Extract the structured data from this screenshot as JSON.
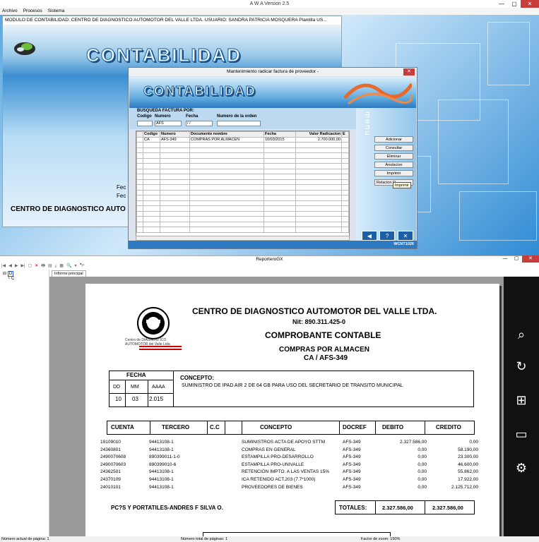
{
  "app": {
    "title": "A W A Version 2.5",
    "menu": [
      "Archivo",
      "Procesos",
      "Sistema"
    ],
    "minimize": "—",
    "maximize": "▢",
    "close": "✕"
  },
  "module": {
    "title": "MODULO DE CONTABILIDAD: CENTRO DE DIAGNOSTICO AUTOMOTOR DEL VALLE LTDA.    USUARIO:  SANDRA PATRICIA MOSQUERA  Plantilla US...",
    "banner": "CONTABILIDAD",
    "fec1": "Fec",
    "fec2": "Fec",
    "company": "CENTRO DE DIAGNOSTICO AUTO"
  },
  "dialog": {
    "title": "Mantenimiento radicar factura de proveedor -",
    "close": "✕",
    "banner": "CONTABILIDAD",
    "search_title": "BUSQUEDA FACTURA POR:",
    "search_labels": {
      "codigo": "Codigo",
      "numero": "Numero",
      "fecha": "Fecha",
      "orden": "Numero de la orden"
    },
    "search_values": {
      "codigo": "",
      "numero": "AFS",
      "fecha": "  /  /",
      "orden": ""
    },
    "grid_headers": [
      "Codigo",
      "Numero",
      "Documento nombre",
      "Fecha",
      "Valor Radicacion",
      "E"
    ],
    "grid_rows": [
      [
        "CA",
        "AFS-349",
        "COMPRAS POR ALMACEN",
        "10/03/2015",
        "2.700.000,00",
        ""
      ]
    ],
    "menu_word": "menu",
    "buttons": [
      "Adicionar",
      "Consultar",
      "Eliminar",
      "Anulacion",
      "Imprimir",
      "Relacion O"
    ],
    "tooltip": "Imprimir",
    "nav": [
      "◀",
      "?",
      "✕"
    ],
    "status_id": "WCNT1026"
  },
  "report": {
    "title": "ReporteroGX",
    "close": "✕",
    "toolbar": [
      "|◀",
      "◀",
      "▶",
      "▶|",
      "▢",
      "✕",
      "🖶",
      "▤",
      "⤓",
      "▦",
      "🔍",
      "▾",
      "🔭"
    ],
    "tree": [
      "D",
      "C"
    ],
    "tab": "Informe principal",
    "company": "CENTRO DE DIAGNOSTICO AUTOMOTOR DEL VALLE LTDA.",
    "nit": "Nit: 890.311.425-0",
    "doc_title": "COMPROBANTE CONTABLE",
    "doc_type": "COMPRAS POR ALMACEN",
    "doc_number": "CA /  AFS-349",
    "logo_text1": "Centro de DIAGNOSTICO",
    "logo_text2": "AUTOMOTOR del Valle Ltda",
    "fecha_label": "FECHA",
    "fecha_heads": [
      "DD",
      "MM",
      "AAAA"
    ],
    "fecha_vals": [
      "10",
      "03",
      "2.015"
    ],
    "concepto_label": "CONCEPTO:",
    "concepto": "SUMINISTRO DE IPAD AIR 2 DE 64 GB PARA USO DEL SECRETARIO DE TRANSITO MUNICIPAL",
    "col_heads": [
      "CUENTA",
      "TERCERO",
      "C.C",
      "CONCEPTO",
      "DOCREF",
      "DEBITO",
      "CREDITO"
    ],
    "rows": [
      [
        "19109010",
        "94413108-1",
        "SUMINISTROS ACTA DE APOYO STTM",
        "AFS-349",
        "2.327.586,00",
        "0,00"
      ],
      [
        "24360801",
        "94413108-1",
        "COMPRAS EN GENERAL",
        "AFS-349",
        "0,00",
        "58.190,00"
      ],
      [
        "2490070608",
        "890399011-1-0",
        "ESTAMPILLA PRO-DESARROLLO",
        "AFS-349",
        "0,00",
        "23.300,00"
      ],
      [
        "2490070603",
        "890399010-6",
        "ESTAMPILLA PRO-UNIVALLE",
        "AFS-349",
        "0,00",
        "46.600,00"
      ],
      [
        "24362501",
        "94413108-1",
        "RETENCIÓN IMPTO. A LAS VENTAS 15%",
        "AFS-349",
        "0,00",
        "55.862,00"
      ],
      [
        "24370109",
        "94413108-1",
        "ICA RETENIDO ACT.203 (7.7*1000)",
        "AFS-349",
        "0,00",
        "17.922,00"
      ],
      [
        "24010101",
        "94413108-1",
        "PROVEEDORES DE BIENES",
        "AFS-349",
        "0,00",
        "2.125.712,00"
      ]
    ],
    "provider": "PC?S Y PORTATILES-ANDRES F SILVA O.",
    "totales_label": "TOTALES:",
    "total_debito": "2.327.586,00",
    "total_credito": "2.327.586,00"
  },
  "charms": [
    "search-icon",
    "share-icon",
    "windows-start-icon",
    "devices-icon",
    "settings-icon"
  ],
  "status": {
    "page": "Número actual de página: 1",
    "total": "Número total de páginas: 1",
    "zoom": "Factor de zoom: 150%"
  }
}
